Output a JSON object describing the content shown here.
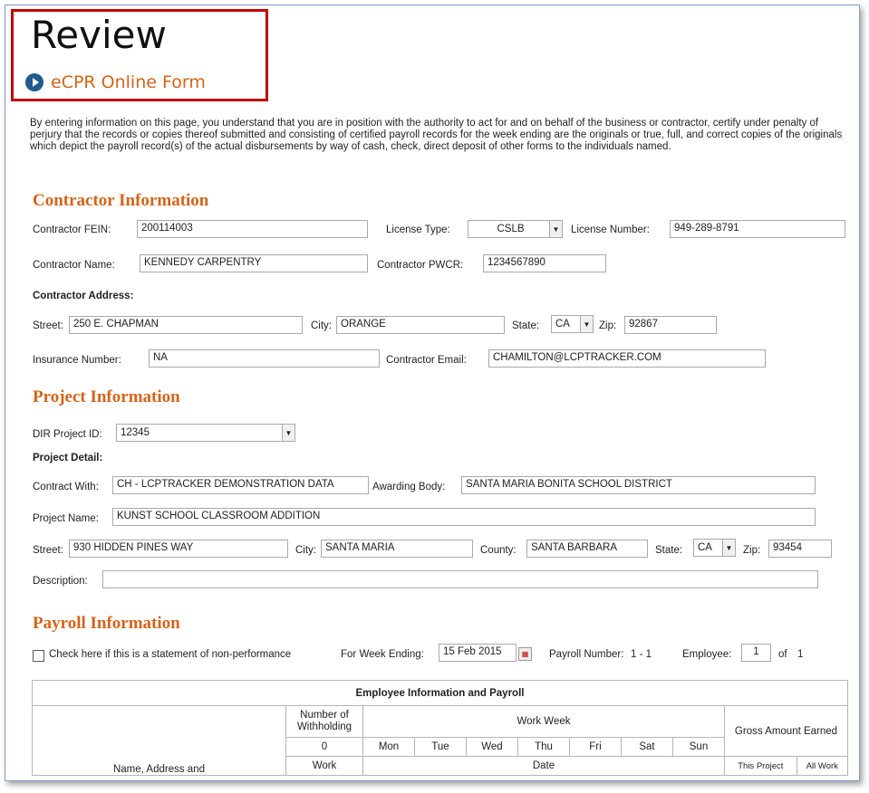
{
  "header": {
    "title": "Review",
    "subtitle": "eCPR Online Form"
  },
  "intro": "By entering information on this page, you understand that you are in position with the authority to act for and on behalf of the business or contractor, certify under penalty of perjury that the records or copies thereof submitted and consisting of certified payroll records for the week ending are the originals or true, full, and correct copies of the originals which depict the payroll record(s) of the actual disbursements by way of cash, check, direct deposit of other forms to the individuals named.",
  "contractor": {
    "heading": "Contractor Information",
    "fein_label": "Contractor FEIN:",
    "fein": "200114003",
    "license_type_label": "License Type:",
    "license_type": "CSLB",
    "license_number_label": "License Number:",
    "license_number": "949-289-8791",
    "name_label": "Contractor Name:",
    "name": "KENNEDY CARPENTRY",
    "pwcr_label": "Contractor PWCR:",
    "pwcr": "1234567890",
    "address_label": "Contractor Address:",
    "street_label": "Street:",
    "street": "250 E. CHAPMAN",
    "city_label": "City:",
    "city": "ORANGE",
    "state_label": "State:",
    "state": "CA",
    "zip_label": "Zip:",
    "zip": "92867",
    "insurance_label": "Insurance Number:",
    "insurance": "NA",
    "email_label": "Contractor Email:",
    "email": "CHAMILTON@LCPTRACKER.COM"
  },
  "project": {
    "heading": "Project Information",
    "dir_label": "DIR Project ID:",
    "dir_id": "12345",
    "detail_label": "Project Detail:",
    "contract_with_label": "Contract With:",
    "contract_with": "CH - LCPTRACKER DEMONSTRATION DATA",
    "awarding_label": "Awarding Body:",
    "awarding": "SANTA MARIA BONITA SCHOOL DISTRICT",
    "name_label": "Project Name:",
    "name": "KUNST SCHOOL CLASSROOM ADDITION",
    "street_label": "Street:",
    "street": "930 HIDDEN PINES WAY",
    "city_label": "City:",
    "city": "SANTA MARIA",
    "county_label": "County:",
    "county": "SANTA BARBARA",
    "state_label": "State:",
    "state": "CA",
    "zip_label": "Zip:",
    "zip": "93454",
    "description_label": "Description:",
    "description": ""
  },
  "payroll": {
    "heading": "Payroll Information",
    "nonperf_label": "Check here if this is a statement of non-performance",
    "week_ending_label": "For Week Ending:",
    "week_ending": "15 Feb 2015",
    "payroll_number_label": "Payroll Number:",
    "payroll_number": "1 - 1",
    "employee_label": "Employee:",
    "employee": "1",
    "of_label": "of",
    "employee_total": "1"
  },
  "table": {
    "title": "Employee Information and Payroll",
    "name_col": "Name, Address and",
    "withholding": "Number of Withholding",
    "withholding_value": "0",
    "work": "Work",
    "work_week": "Work Week",
    "days": [
      "Mon",
      "Tue",
      "Wed",
      "Thu",
      "Fri",
      "Sat",
      "Sun"
    ],
    "date": "Date",
    "gross": "Gross Amount Earned",
    "this_project": "This Project",
    "all_work": "All Work"
  },
  "colors": {
    "accent": "#d4641a",
    "highlight_border": "#c00000",
    "icon": "#1e5b8e"
  }
}
